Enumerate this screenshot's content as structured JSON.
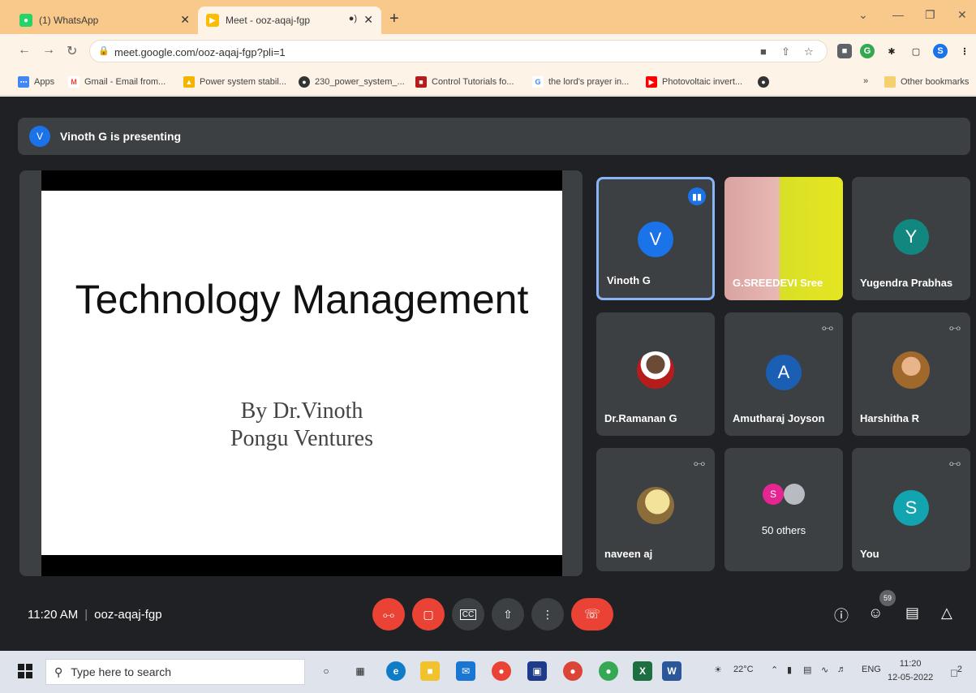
{
  "browser": {
    "tabs": [
      {
        "label": "(1) WhatsApp",
        "favicon": "whatsapp-icon",
        "color": "#25d366"
      },
      {
        "label": "Meet - ooz-aqaj-fgp",
        "favicon": "meet-icon",
        "color": "#fbbc04"
      }
    ],
    "url": "meet.google.com/ooz-aqaj-fgp?pli=1",
    "bookmarks": [
      "Apps",
      "Gmail - Email from...",
      "Power system stabil...",
      "230_power_system_...",
      "Control Tutorials fo...",
      "the lord's prayer in...",
      "Photovoltaic invert...",
      "Other bookmarks"
    ]
  },
  "meet": {
    "presenting_avatar": "V",
    "presenting_text": "Vinoth G is presenting",
    "slide": {
      "title": "Technology Management",
      "byline1": "By Dr.Vinoth",
      "byline2": "Pongu Ventures"
    },
    "participants": [
      {
        "name": "Vinoth G",
        "initial": "V",
        "color": "#1a73e8",
        "speaking": true
      },
      {
        "name": "G.SREEDEVI Sree",
        "type": "video"
      },
      {
        "name": "Yugendra Prabhas",
        "initial": "Y",
        "color": "#12877f"
      },
      {
        "name": "Dr.Ramanan G",
        "type": "photo",
        "muted": false
      },
      {
        "name": "Amutharaj Joyson",
        "initial": "A",
        "color": "#1a5fb4",
        "muted": true
      },
      {
        "name": "Harshitha R",
        "type": "photo",
        "muted": true
      },
      {
        "name": "naveen aj",
        "type": "photo",
        "muted": true
      },
      {
        "name": "50 others",
        "initial": "S",
        "color": "#e52592"
      },
      {
        "name": "You",
        "initial": "S",
        "color": "#12a4af",
        "muted": true
      }
    ],
    "time": "11:20 AM",
    "meeting_code": "ooz-aqaj-fgp",
    "people_count": "59"
  },
  "taskbar": {
    "search_placeholder": "Type here to search",
    "weather": "22°C",
    "lang": "ENG",
    "time": "11:20",
    "date": "12-05-2022",
    "notifications": "2"
  }
}
